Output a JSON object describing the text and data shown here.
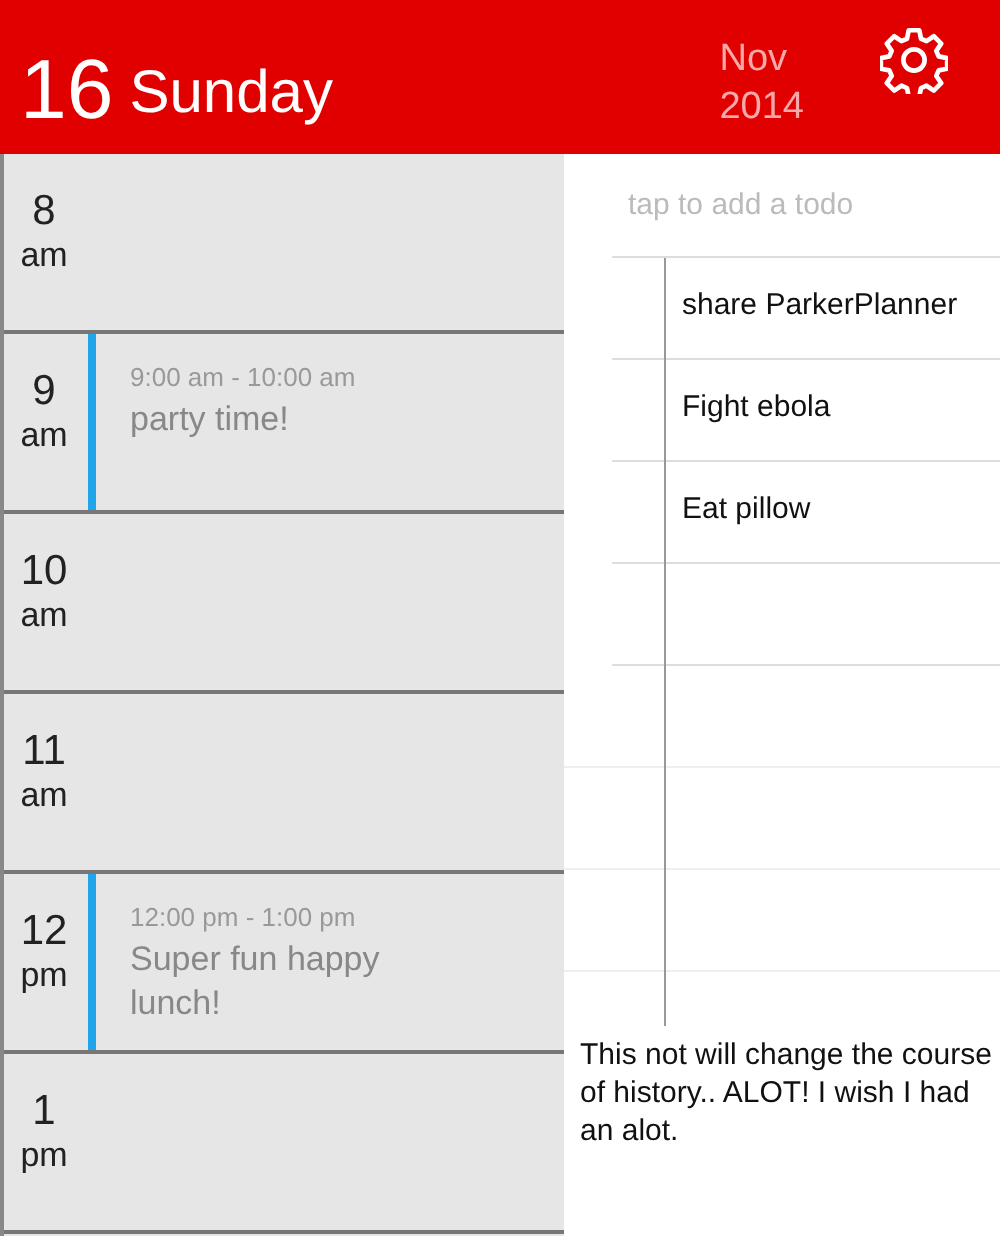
{
  "header": {
    "day_number": "16",
    "weekday": "Sunday",
    "month": "Nov",
    "year": "2014"
  },
  "hours": [
    {
      "hour": "8",
      "period": "am"
    },
    {
      "hour": "9",
      "period": "am",
      "event": {
        "time": "9:00 am - 10:00 am",
        "title": "party time!"
      }
    },
    {
      "hour": "10",
      "period": "am"
    },
    {
      "hour": "11",
      "period": "am"
    },
    {
      "hour": "12",
      "period": "pm",
      "event": {
        "time": "12:00 pm - 1:00 pm",
        "title": "Super fun happy lunch!"
      }
    },
    {
      "hour": "1",
      "period": "pm"
    }
  ],
  "todo": {
    "placeholder": "tap to add a todo",
    "items": [
      "share ParkerPlanner",
      "Fight ebola",
      "Eat pillow"
    ]
  },
  "note": "This not will change the course of history.. ALOT! I wish I had an alot."
}
